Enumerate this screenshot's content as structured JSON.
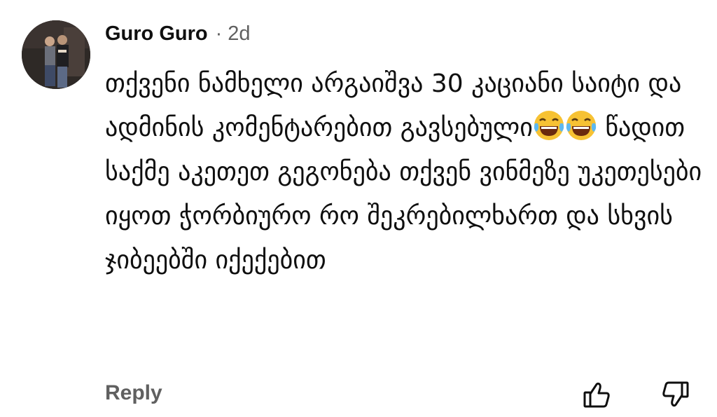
{
  "comment": {
    "author": "Guro Guro",
    "separator": "·",
    "age": "2d",
    "text_before_emoji": "თქვენი ნამხელი არგაიშვა 30 კაციანი საიტი და ადმინის კომენტარებით გავსებული",
    "emoji": [
      "face-with-tears-of-joy",
      "face-with-tears-of-joy"
    ],
    "text_after_emoji": " წადით საქმე აკეთეთ გეგონება თქვენ ვინმეზე უკეთესები იყოთ ჭორბიურო რო შეკრებილხართ და სხვის ჯიბეებში იქექებით"
  },
  "actions": {
    "reply_label": "Reply",
    "like_icon": "thumbs-up-icon",
    "dislike_icon": "thumbs-down-icon"
  },
  "colors": {
    "text": "#0f0f0f",
    "secondary": "#606060",
    "background": "#ffffff"
  }
}
